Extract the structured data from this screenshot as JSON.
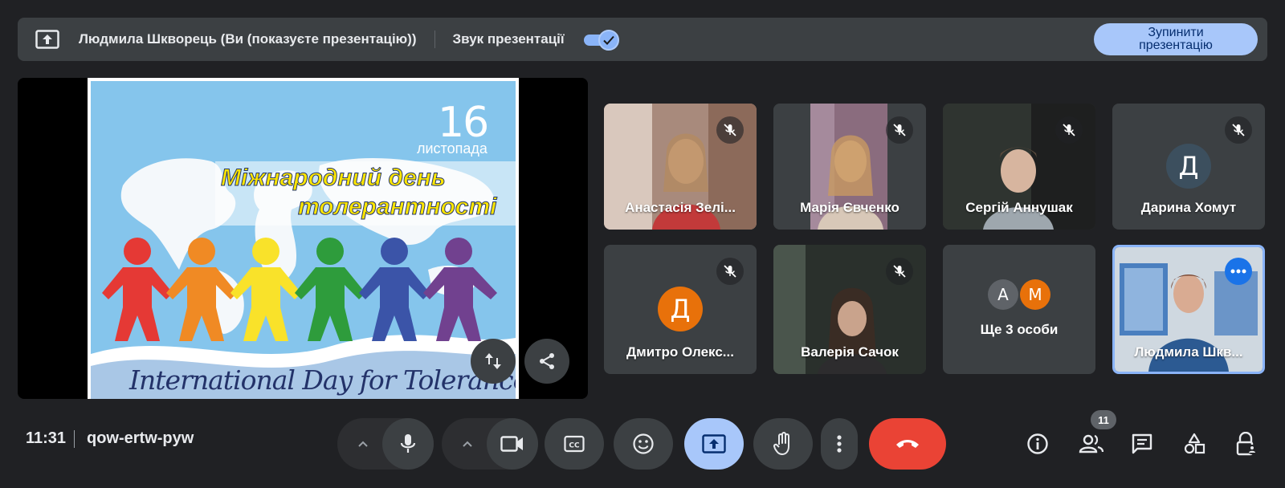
{
  "banner": {
    "presenter_text": "Людмила Шкворець (Ви (показуєте презентацію))",
    "sound_label": "Звук презентації",
    "sound_enabled": true,
    "stop_button": "Зупинити презентацію"
  },
  "slide": {
    "date_number": "16",
    "date_month": "листопада",
    "title_line1": "Міжнародний день",
    "title_line2": "толерантності",
    "caption": "International Day for Tolerance"
  },
  "participants": [
    {
      "name": "Анастасія Зелі...",
      "muted": true,
      "type": "video"
    },
    {
      "name": "Марія Євченко",
      "muted": true,
      "type": "video"
    },
    {
      "name": "Сергій Аннушак",
      "muted": true,
      "type": "video"
    },
    {
      "name": "Дарина Хомут",
      "muted": true,
      "type": "avatar",
      "initial": "Д",
      "color": "#3c4f5e"
    },
    {
      "name": "Дмитро Олекс...",
      "muted": true,
      "type": "avatar",
      "initial": "Д",
      "color": "#e8710a"
    },
    {
      "name": "Валерія Сачок",
      "muted": true,
      "type": "video"
    },
    {
      "name": "Ще 3 особи",
      "type": "group",
      "initials": [
        "А",
        "М"
      ]
    },
    {
      "name": "Людмила Шкв...",
      "type": "video",
      "self": true
    }
  ],
  "bottom": {
    "time": "11:31",
    "meeting_code": "qow-ertw-pyw",
    "participant_count": "11"
  },
  "colors": {
    "accent": "#8ab4f8",
    "hangup": "#ea4335",
    "present_active": "#a8c7fa"
  }
}
